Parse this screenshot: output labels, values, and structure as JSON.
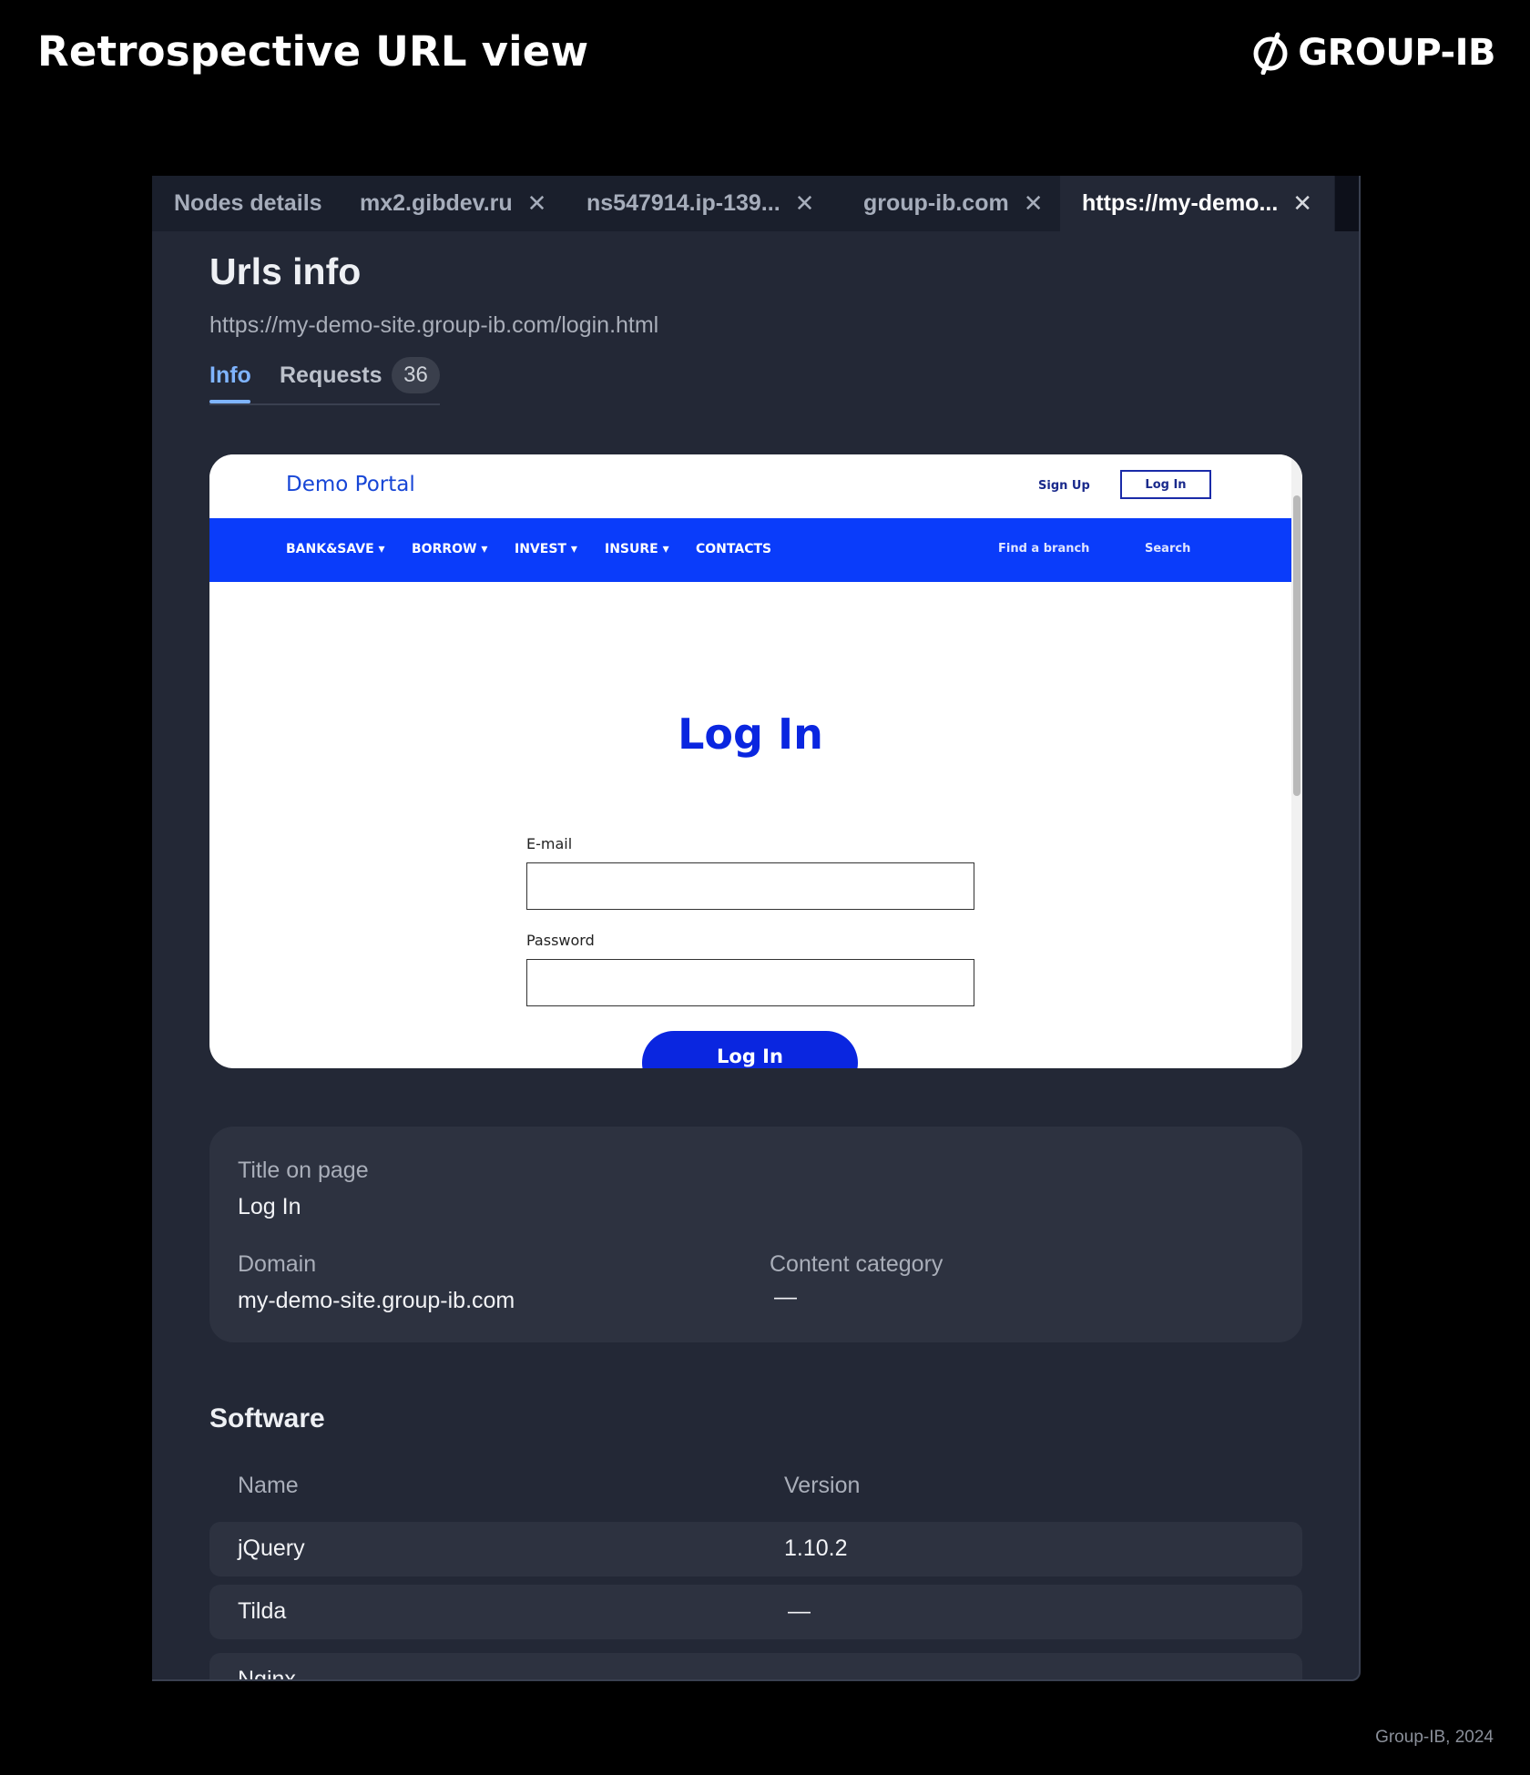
{
  "header": {
    "title": "Retrospective URL view",
    "brand": "GROUP-IB"
  },
  "tabs": [
    {
      "label": "Nodes details",
      "closable": false,
      "active": false
    },
    {
      "label": "mx2.gibdev.ru",
      "closable": true,
      "active": false
    },
    {
      "label": "ns547914.ip-139...",
      "closable": true,
      "active": false
    },
    {
      "label": "group-ib.com",
      "closable": true,
      "active": false
    },
    {
      "label": "https://my-demo...",
      "closable": true,
      "active": true
    }
  ],
  "icons": {
    "close": "close-icon",
    "brand_logo": "group-ib-logo-icon"
  },
  "urls_info": {
    "title": "Urls info",
    "url": "https://my-demo-site.group-ib.com/login.html",
    "subtabs": {
      "info": "Info",
      "requests": "Requests",
      "requests_count": "36"
    }
  },
  "preview": {
    "brand": "Demo Portal",
    "sign_up": "Sign Up",
    "log_in": "Log In",
    "nav": [
      "BANK&SAVE ▾",
      "BORROW ▾",
      "INVEST ▾",
      "INSURE ▾",
      "CONTACTS"
    ],
    "find_branch": "Find a branch",
    "search": "Search",
    "heading": "Log In",
    "email_label": "E-mail",
    "password_label": "Password",
    "submit": "Log In",
    "accent_color": "#0a3cfa"
  },
  "info_card": {
    "title_label": "Title on page",
    "title_value": "Log In",
    "domain_label": "Domain",
    "domain_value": "my-demo-site.group-ib.com",
    "category_label": "Content category",
    "category_value": "—"
  },
  "software": {
    "title": "Software",
    "columns": [
      "Name",
      "Version"
    ],
    "rows": [
      {
        "name": "jQuery",
        "version": "1.10.2"
      },
      {
        "name": "Tilda",
        "version": "—"
      },
      {
        "name": "Nginx",
        "version": ""
      }
    ]
  },
  "footer": "Group-IB, 2024"
}
